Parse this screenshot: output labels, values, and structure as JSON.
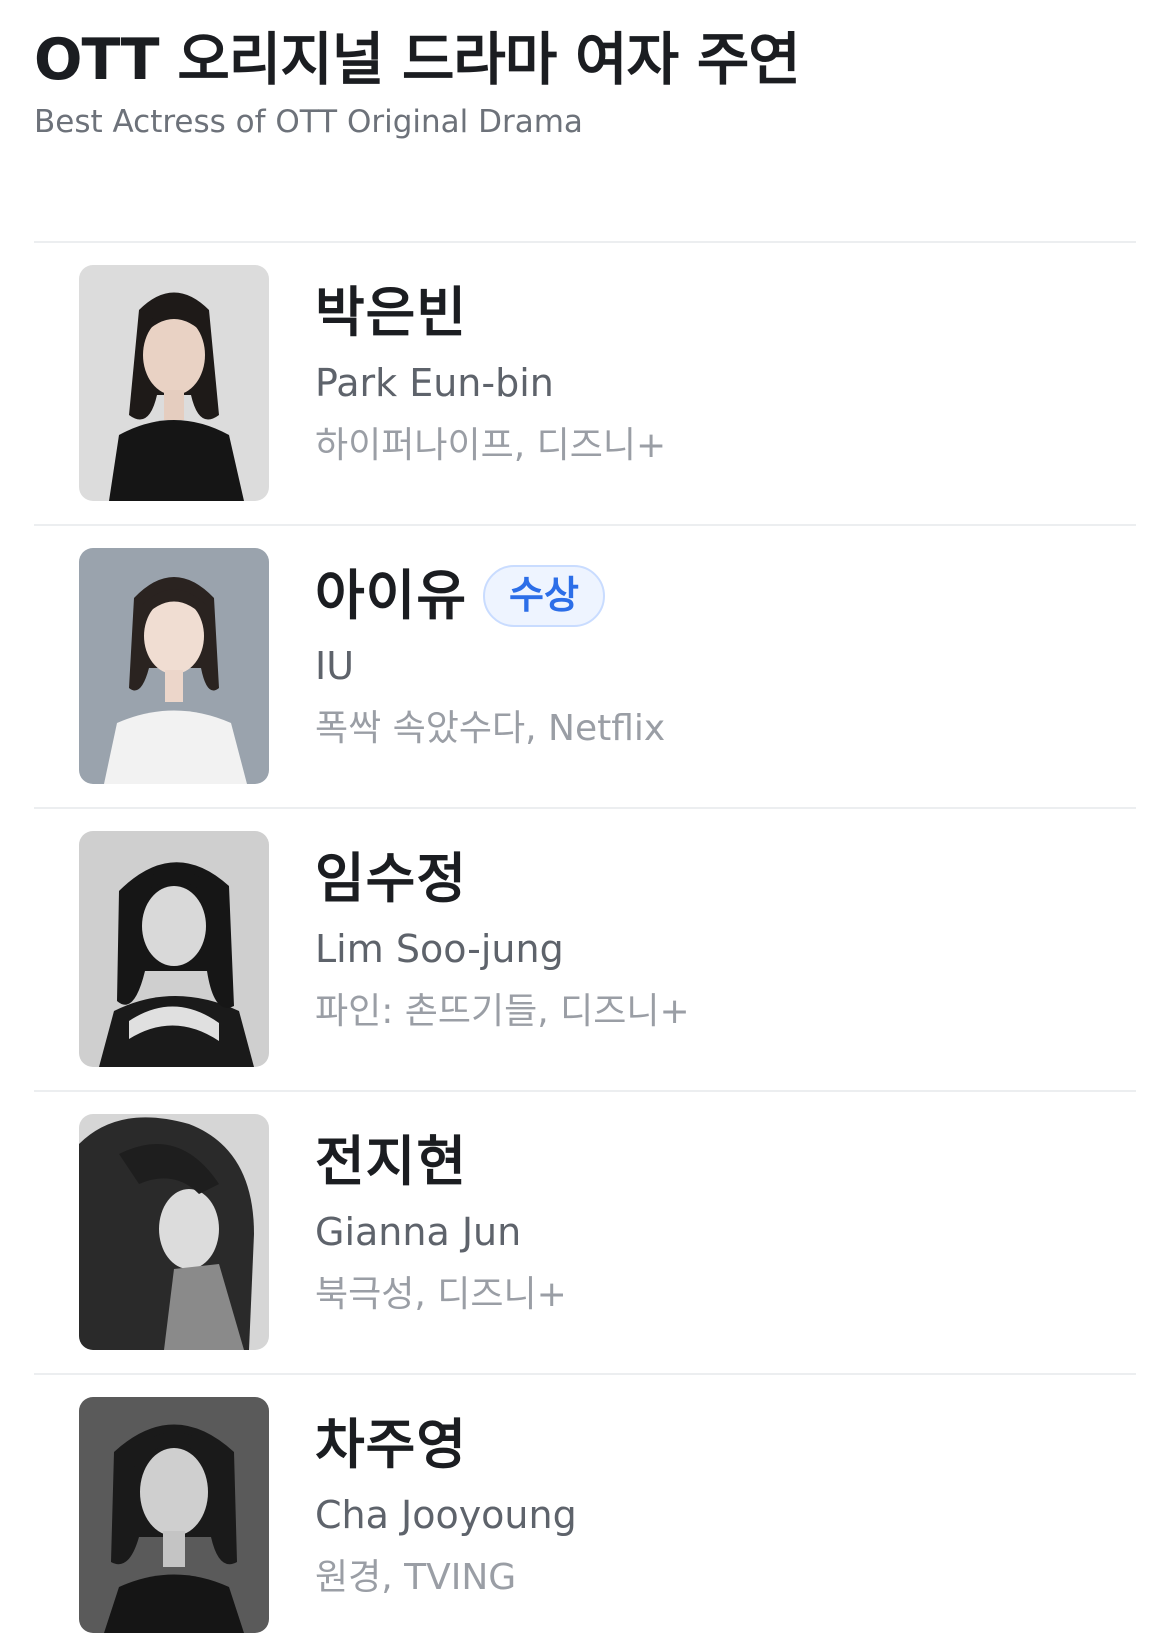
{
  "header": {
    "title": "OTT 오리지널 드라마 여자 주연",
    "subtitle": "Best Actress of OTT Original Drama"
  },
  "nominees": [
    {
      "name_ko": "박은빈",
      "name_en": "Park Eun-bin",
      "work": "하이퍼나이프, 디즈니+",
      "badge": ""
    },
    {
      "name_ko": "아이유",
      "name_en": "IU",
      "work": "폭싹 속았수다, Netflix",
      "badge": "수상"
    },
    {
      "name_ko": "임수정",
      "name_en": "Lim Soo-jung",
      "work": "파인: 촌뜨기들, 디즈니+",
      "badge": ""
    },
    {
      "name_ko": "전지현",
      "name_en": "Gianna Jun",
      "work": "북극성, 디즈니+",
      "badge": ""
    },
    {
      "name_ko": "차주영",
      "name_en": "Cha Jooyoung",
      "work": "원경, TVING",
      "badge": ""
    }
  ],
  "colors": {
    "badge_text": "#2c6ee8",
    "badge_bg": "#eef4ff",
    "divider": "#eceef0"
  }
}
